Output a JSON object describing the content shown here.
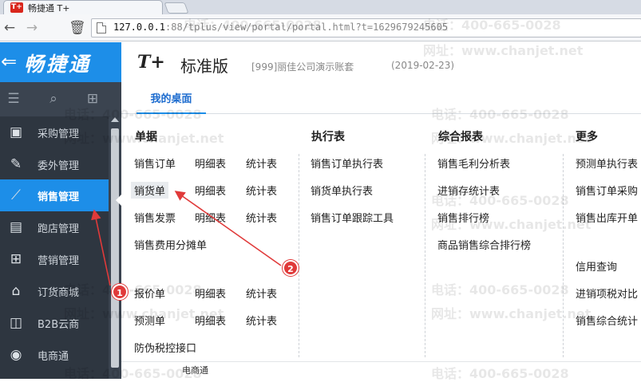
{
  "browser": {
    "tab_title": "畅捷通 T+",
    "favicon_text": "T+",
    "url_host": "127.0.0.1",
    "url_rest": ":88/tplus/view/portal/portal.html?t=1629679245605"
  },
  "app": {
    "logo_text": "畅捷通",
    "product_mark": "T+",
    "product_name": "标准版",
    "company": "[999]丽佳公司演示账套",
    "date": "(2019-02-23)"
  },
  "sidebar": {
    "items": [
      {
        "label": "采购管理",
        "icon": "cart-icon"
      },
      {
        "label": "委外管理",
        "icon": "outsource-icon"
      },
      {
        "label": "销售管理",
        "icon": "chart-icon",
        "active": true
      },
      {
        "label": "跑店管理",
        "icon": "person-card-icon"
      },
      {
        "label": "营销管理",
        "icon": "grid-icon"
      },
      {
        "label": "订货商城",
        "icon": "store-icon"
      },
      {
        "label": "B2B云商",
        "icon": "bag-icon"
      },
      {
        "label": "电商通",
        "icon": "ecommerce-icon"
      }
    ]
  },
  "desk": {
    "tab_label": "我的桌面"
  },
  "menu": {
    "columns": {
      "documents": "单据",
      "execution": "执行表",
      "reports": "综合报表",
      "more": "更多"
    },
    "documents": {
      "sales_order": "销售订单",
      "sales_order_detail": "明细表",
      "sales_order_stats": "统计表",
      "delivery_note": "销货单",
      "delivery_note_detail": "明细表",
      "delivery_note_stats": "统计表",
      "sales_invoice": "销售发票",
      "sales_invoice_detail": "明细表",
      "sales_invoice_stats": "统计表",
      "expense_allocation": "销售费用分摊单",
      "quotation": "报价单",
      "quotation_detail": "明细表",
      "quotation_stats": "统计表",
      "forecast": "预测单",
      "forecast_detail": "明细表",
      "forecast_stats": "统计表",
      "anti_counterfeit": "防伪税控接口"
    },
    "execution": {
      "sales_order_exec": "销售订单执行表",
      "delivery_note_exec": "销货单执行表",
      "sales_order_tracking": "销售订单跟踪工具"
    },
    "reports": {
      "gross_profit": "销售毛利分析表",
      "inventory_stats": "进销存统计表",
      "ranking": "销售排行榜",
      "product_ranking": "商品销售综合排行榜"
    },
    "more": {
      "forecast_exec": "预测单执行表",
      "sales_order_purchase": "销售订单采购",
      "sales_outbound": "销售出库开单",
      "credit_query": "信用查询",
      "tax_compare": "进销项税对比",
      "sales_summary": "销售综合统计"
    },
    "bottom_cut_item": "电商通"
  },
  "watermark": {
    "phone": "电话：400-665-0028",
    "site": "网址：www.chanjet.net"
  },
  "annotations": {
    "badge1": "1",
    "badge2": "2",
    "color": "#e03a3a"
  }
}
